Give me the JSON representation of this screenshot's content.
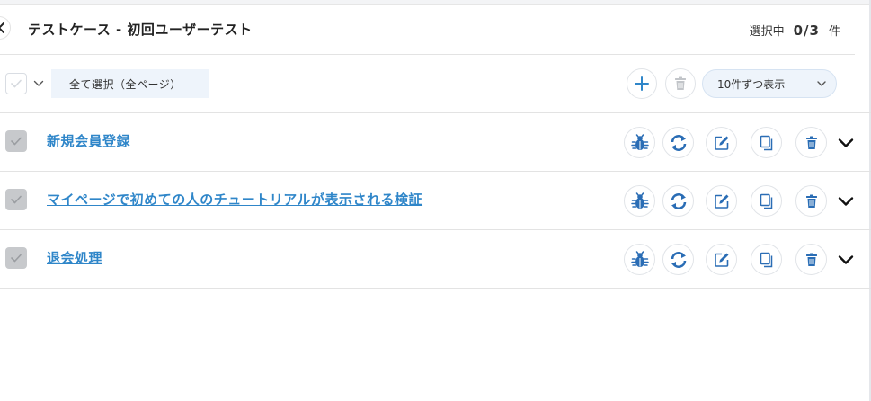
{
  "header": {
    "title": "テストケース - 初回ユーザーテスト",
    "selection_label": "選択中",
    "selection_count": "0/3",
    "selection_unit": "件"
  },
  "toolbar": {
    "select_all_label": "全て選択（全ページ）",
    "per_page_label": "10件ずつ表示"
  },
  "rows": [
    {
      "label": "新規会員登録"
    },
    {
      "label": "マイページで初めての人のチュートリアルが表示される検証"
    },
    {
      "label": "退会処理"
    }
  ],
  "icons": {
    "back": "chevron-left-icon",
    "add": "plus-icon",
    "delete": "trash-icon",
    "bug": "bug-icon",
    "sync": "sync-icon",
    "edit": "edit-icon",
    "copy": "copy-icon",
    "expand": "chevron-down-icon"
  },
  "colors": {
    "accent": "#2f86c9",
    "icon_blue": "#2a6db5",
    "disabled": "#c7c9cc",
    "highlight_bg": "#eef4fb"
  }
}
